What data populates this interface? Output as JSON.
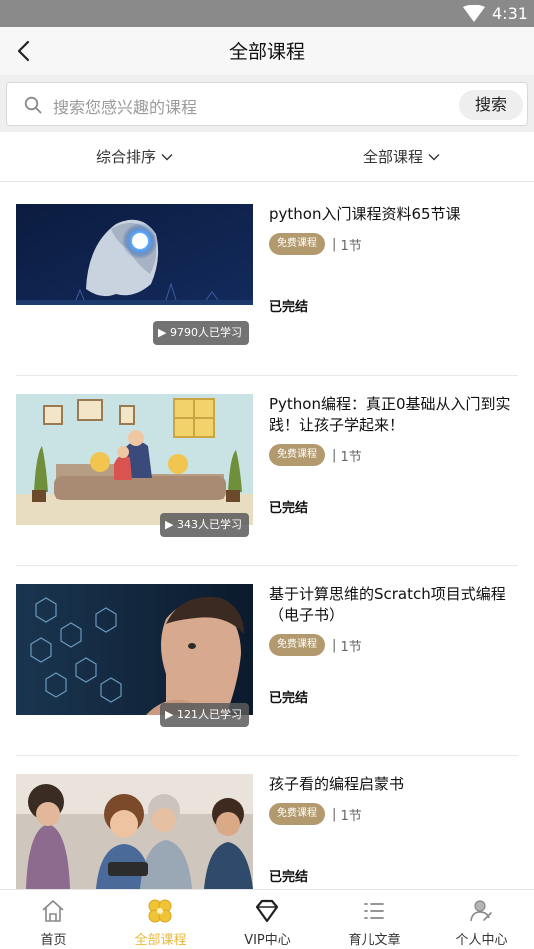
{
  "status": {
    "time": "4:31"
  },
  "header": {
    "title": "全部课程"
  },
  "search": {
    "placeholder": "搜索您感兴趣的课程",
    "button": "搜索"
  },
  "filters": {
    "sort": "综合排序",
    "category": "全部课程"
  },
  "courses": [
    {
      "title": "python入门课程资料65节课",
      "tag": "免费课程",
      "lessons": "1节",
      "status": "已完结",
      "learners": "9790人已学习"
    },
    {
      "title": "Python编程：真正0基础从入门到实践！让孩子学起来！",
      "tag": "免费课程",
      "lessons": "1节",
      "status": "已完结",
      "learners": "343人已学习"
    },
    {
      "title": "基于计算思维的Scratch项目式编程（电子书）",
      "tag": "免费课程",
      "lessons": "1节",
      "status": "已完结",
      "learners": "121人已学习"
    },
    {
      "title": "孩子看的编程启蒙书",
      "tag": "免费课程",
      "lessons": "1节",
      "status": "已完结",
      "learners": ""
    }
  ],
  "meta_separator": "|",
  "tabbar": {
    "items": [
      {
        "label": "首页",
        "icon": "home-icon"
      },
      {
        "label": "全部课程",
        "icon": "clover-icon",
        "active": true
      },
      {
        "label": "VIP中心",
        "icon": "diamond-icon"
      },
      {
        "label": "育儿文章",
        "icon": "list-icon"
      },
      {
        "label": "个人中心",
        "icon": "user-icon"
      }
    ]
  },
  "colors": {
    "accent": "#e8b93a",
    "tag": "#b39a6e",
    "statusbar": "#8a8a8a"
  }
}
